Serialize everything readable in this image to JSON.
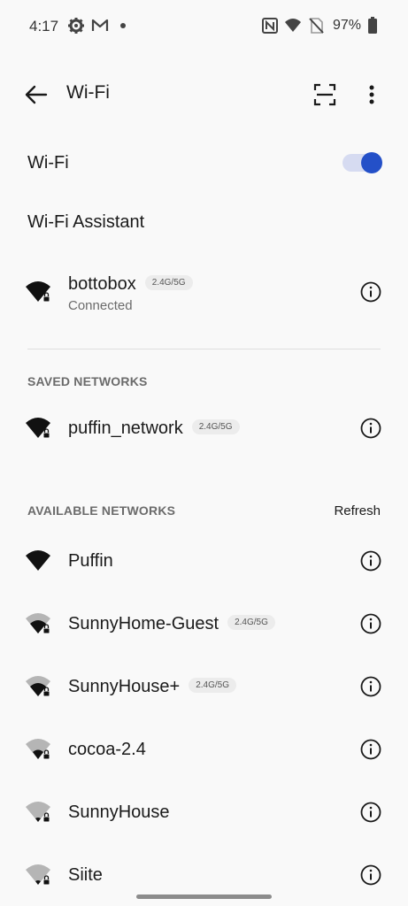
{
  "status_bar": {
    "time": "4:17",
    "battery": "97%",
    "icons": [
      "settings-icon",
      "gmail-icon",
      "notification-dot-icon",
      "nfc-icon",
      "wifi-icon",
      "no-sim-icon",
      "battery-icon"
    ]
  },
  "app_bar": {
    "title": "Wi-Fi",
    "back_icon": "arrow-back-icon",
    "scan_icon": "qr-scan-icon",
    "more_icon": "more-vert-icon"
  },
  "wifi_toggle": {
    "label": "Wi-Fi",
    "state": "on",
    "accent": "#2450c8"
  },
  "assistant": {
    "label": "Wi-Fi Assistant"
  },
  "connected": {
    "name": "bottobox",
    "band": "2.4G/5G",
    "status": "Connected"
  },
  "saved": {
    "header": "SAVED NETWORKS",
    "items": [
      {
        "name": "puffin_network",
        "band": "2.4G/5G"
      }
    ]
  },
  "available": {
    "header": "AVAILABLE NETWORKS",
    "refresh": "Refresh",
    "items": [
      {
        "name": "Puffin",
        "band": "",
        "signal": "full",
        "locked": false
      },
      {
        "name": "SunnyHome-Guest",
        "band": "2.4G/5G",
        "signal": "medium",
        "locked": true
      },
      {
        "name": "SunnyHouse+",
        "band": "2.4G/5G",
        "signal": "medium",
        "locked": true
      },
      {
        "name": "cocoa-2.4",
        "band": "",
        "signal": "low",
        "locked": true
      },
      {
        "name": "SunnyHouse",
        "band": "",
        "signal": "weak",
        "locked": true
      },
      {
        "name": "Siite",
        "band": "",
        "signal": "weak",
        "locked": true
      }
    ]
  }
}
